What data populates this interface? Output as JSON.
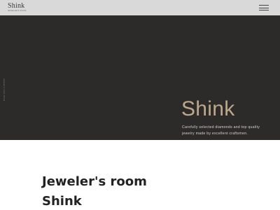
{
  "header": {
    "logo_text": "Shink",
    "logo_tagline": "JEWELER'S ROOM",
    "menu_icon": "hamburger-menu-icon"
  },
  "hero": {
    "side_text": "Jeweler's room Shink",
    "title": "Shink",
    "description": "Carefully selected diamonds and top quality jewelry made by excellent craftsmen."
  },
  "intro": {
    "title_line1": "Jeweler's room",
    "title_line2": "Shink"
  },
  "colors": {
    "header_bg": "#d9d9d9",
    "hero_bg": "#2c2b29",
    "accent_gold": "#bda88a"
  }
}
